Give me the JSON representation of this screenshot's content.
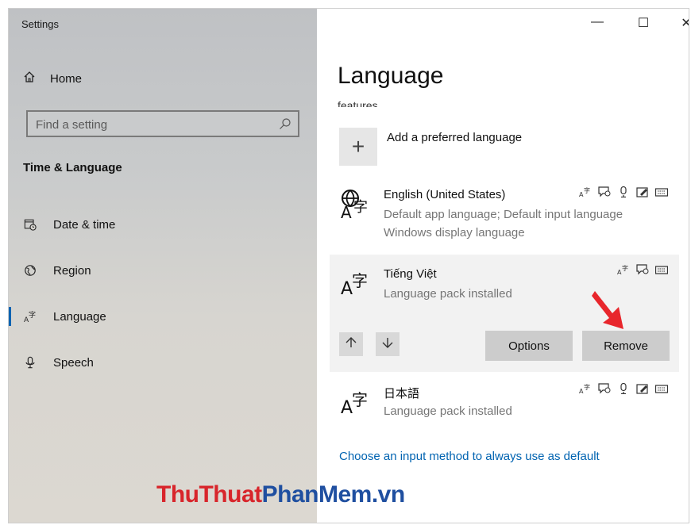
{
  "app_title": "Settings",
  "sidebar": {
    "home_label": "Home",
    "search_placeholder": "Find a setting",
    "section_title": "Time & Language",
    "items": [
      {
        "label": "Date & time",
        "icon": "calendar-clock-icon",
        "selected": false
      },
      {
        "label": "Region",
        "icon": "globe-icon",
        "selected": false
      },
      {
        "label": "Language",
        "icon": "language-icon",
        "selected": true
      },
      {
        "label": "Speech",
        "icon": "microphone-icon",
        "selected": false
      }
    ]
  },
  "window_controls": {
    "minimize": "—",
    "maximize": "☐",
    "close": "✕"
  },
  "main": {
    "title": "Language",
    "clipped_text": "features.",
    "add_label": "Add a preferred language",
    "languages": [
      {
        "name": "English (United States)",
        "desc1": "Default app language; Default input language",
        "desc2": "Windows display language"
      },
      {
        "name": "Tiếng Việt",
        "desc1": "Language pack installed"
      },
      {
        "name": "日本語",
        "desc1": "Language pack installed"
      }
    ],
    "options_label": "Options",
    "remove_label": "Remove",
    "link_text": "Choose an input method to always use as default"
  },
  "watermark": {
    "part1": "ThuThuat",
    "part2": "PhanMem",
    "part3": ".vn"
  },
  "colors": {
    "accent": "#0063b1",
    "annotation_arrow": "#e8262c",
    "watermark_red": "#d8252b",
    "watermark_blue": "#1f4fa0"
  }
}
